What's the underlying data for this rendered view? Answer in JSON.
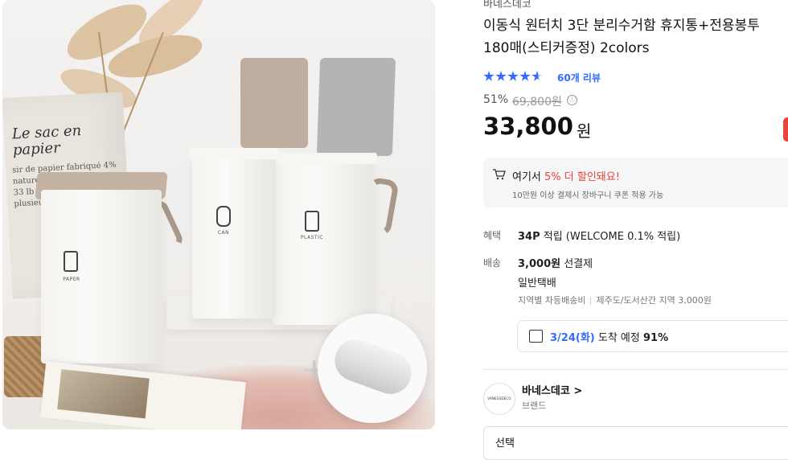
{
  "product_image": {
    "bag_text": "Le sac en papier",
    "bag_small_text": "sir de papier fabriqué 4% naturel 3 blanc épaisseur 33 lb Ecographik. 3 vie plusieurs",
    "bin_labels": [
      "PAPER",
      "CAN",
      "PLASTIC"
    ],
    "plus_symbol": "+",
    "lid_colors": [
      "#bfae9f",
      "#b0b0b0",
      "#c4b2a2"
    ]
  },
  "product": {
    "brand_top": "바네스데코",
    "title": "이동식 원터치 3단 분리수거함 휴지통+전용봉투 180매(스티커증정) 2colors",
    "rating": 4.5,
    "review_count": "60개 리뷰",
    "discount_rate": "51%",
    "original_price": "69,800원",
    "info_icon": "ⓘ",
    "price": "33,800",
    "price_unit": "원"
  },
  "promo": {
    "line_prefix": "여기서 ",
    "line_highlight": "5% 더 할인돼요!",
    "sub": "10만원 이상 결제시 장바구니 쿠폰 적용 가능"
  },
  "benefits": {
    "label": "혜택",
    "points": "34P",
    "text": " 적립 (WELCOME 0.1% 적립)"
  },
  "shipping": {
    "label": "배송",
    "fee": "3,000원",
    "fee_suffix": " 선결제",
    "method": "일반택배",
    "regional_label": "지역별 차등배송비",
    "regional_detail": "제주도/도서산간 지역 3,000원"
  },
  "arrival": {
    "date": "3/24(화)",
    "text": " 도착 예정 ",
    "percent": "91%"
  },
  "store": {
    "logo_text": "VANESSDECO",
    "name": "바네스데코",
    "chevron": ">",
    "sub": "브랜드"
  },
  "option_select": {
    "label": "선택"
  },
  "colors": {
    "accent_blue": "#346aff",
    "accent_red": "#e8453c"
  }
}
